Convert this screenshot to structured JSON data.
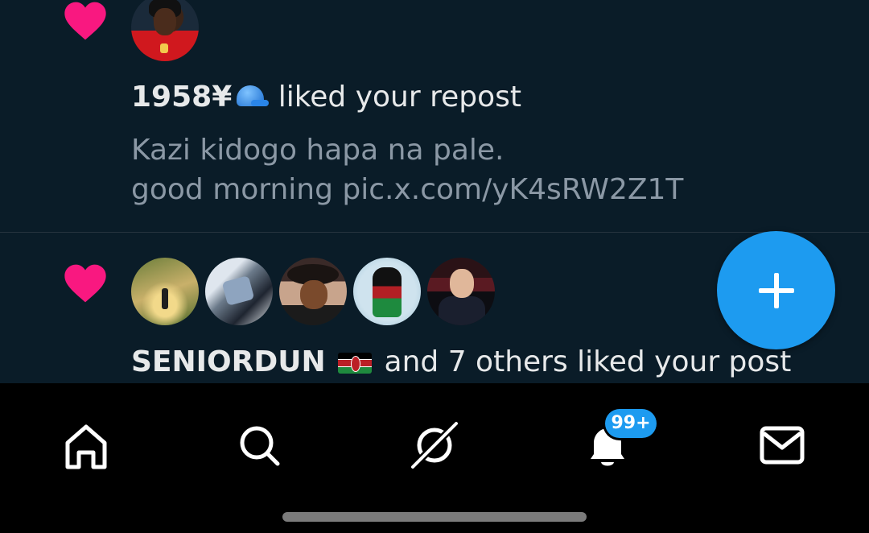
{
  "notifications": [
    {
      "type_icon": "heart-icon",
      "actor": "1958¥",
      "actor_emoji": "blue-cap-emoji",
      "action": "liked your repost",
      "post_lines": [
        "Kazi kidogo hapa na pale.",
        "good morning pic.x.com/yK4sRW2Z1T"
      ]
    },
    {
      "type_icon": "heart-icon",
      "actor": "SENIORDUN",
      "actor_emoji": "kenya-flag-emoji",
      "action": "and 7 others liked your post",
      "avatar_count": 5
    }
  ],
  "fab": {
    "icon": "plus-icon",
    "color": "#1d9bf0"
  },
  "tabbar": {
    "tabs": [
      {
        "name": "home",
        "icon": "home-icon"
      },
      {
        "name": "search",
        "icon": "search-icon"
      },
      {
        "name": "grok",
        "icon": "grok-icon"
      },
      {
        "name": "notifications",
        "icon": "bell-icon"
      },
      {
        "name": "messages",
        "icon": "mail-icon"
      }
    ],
    "notif_badge": "99+"
  },
  "colors": {
    "accent": "#1d9bf0",
    "like": "#f91880",
    "background": "#0a1c28"
  }
}
